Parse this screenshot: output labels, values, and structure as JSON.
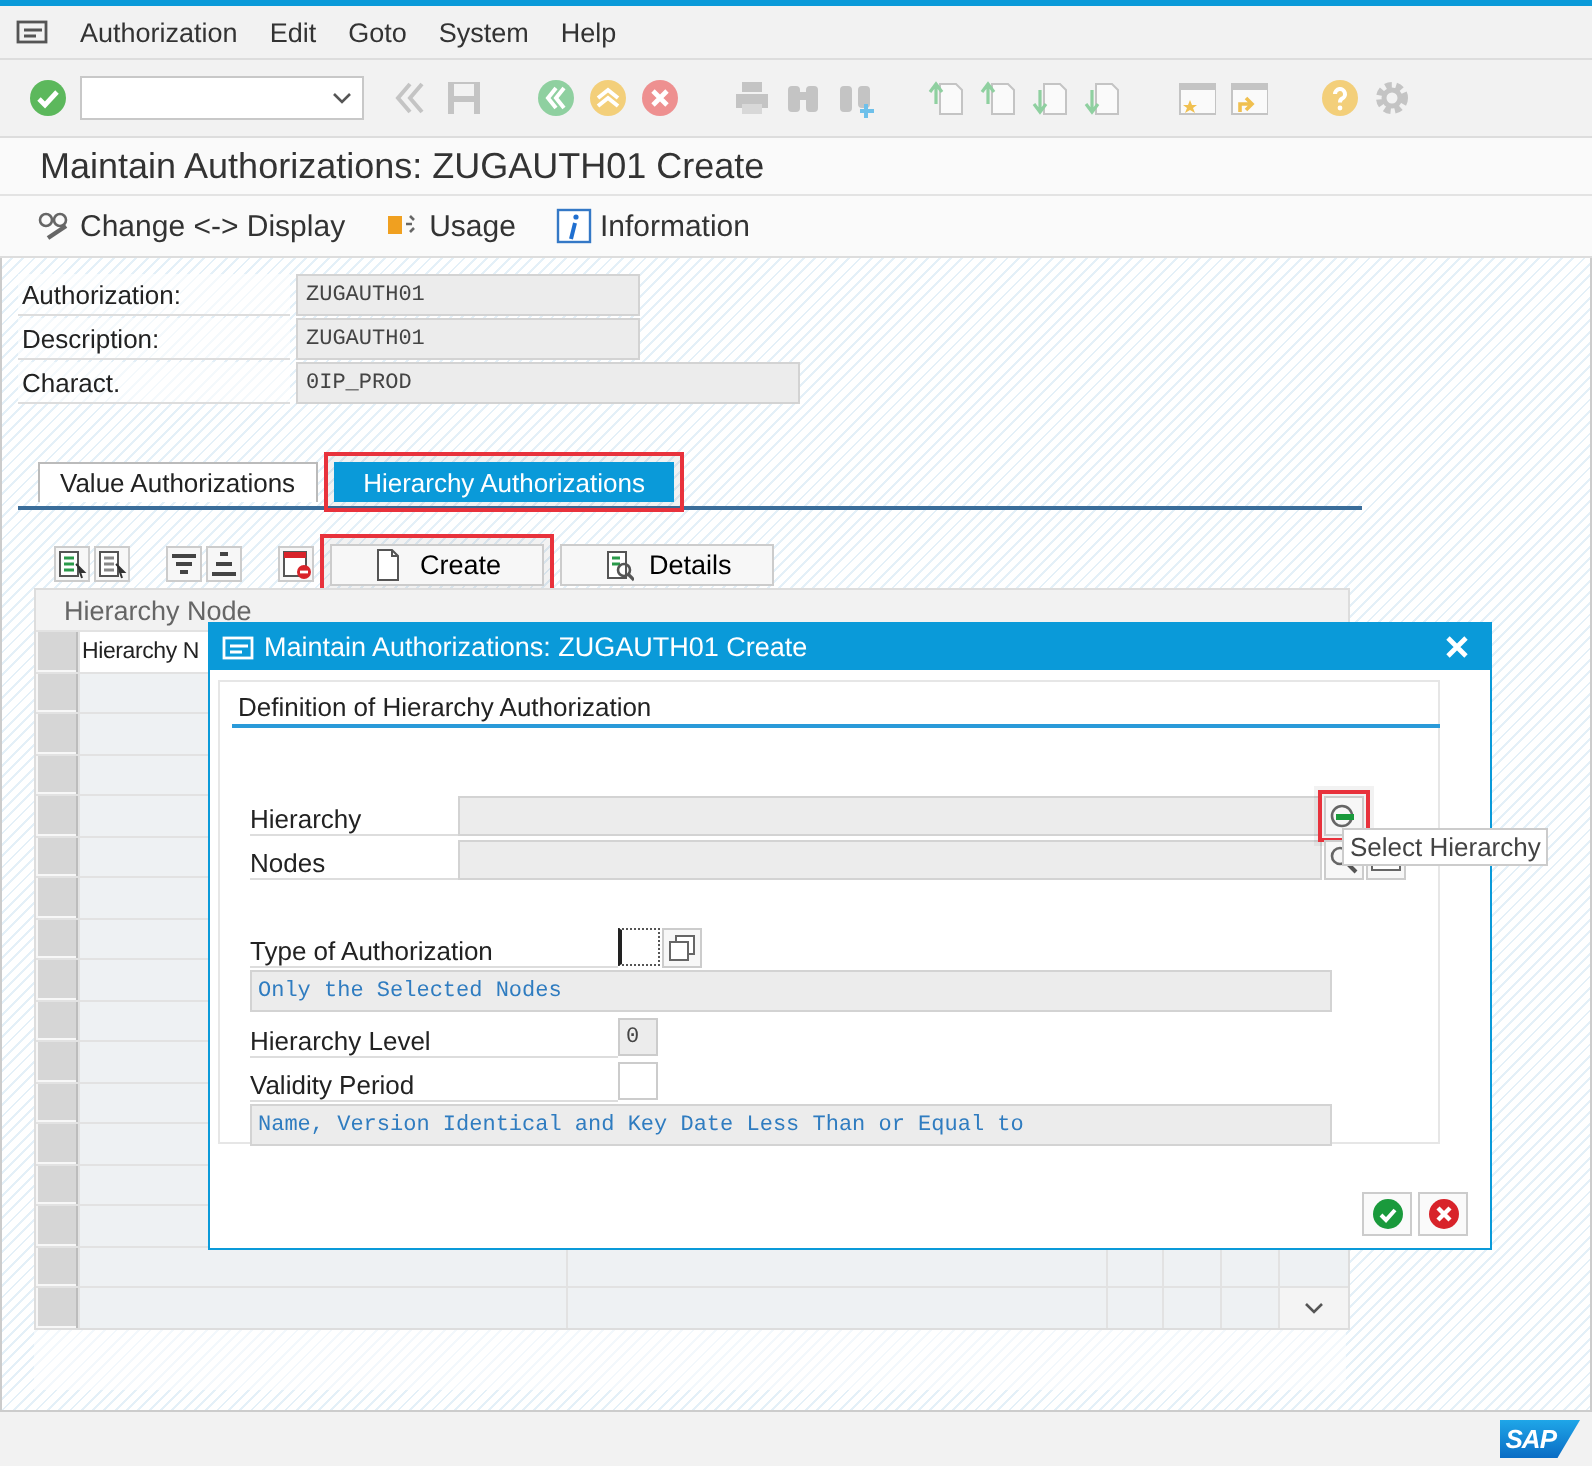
{
  "menu_bar": {
    "items": [
      "Authorization",
      "Edit",
      "Goto",
      "System",
      "Help"
    ]
  },
  "title": "Maintain Authorizations: ZUGAUTH01 Create",
  "app_toolbar": {
    "buttons": [
      {
        "kind": "glasses",
        "label": "Change <-> Display"
      },
      {
        "kind": "usage",
        "label": "Usage"
      },
      {
        "kind": "info",
        "label": "Information"
      }
    ]
  },
  "header_fields": [
    {
      "label": "Authorization:",
      "value": "ZUGAUTH01"
    },
    {
      "label": "Description:",
      "value": "ZUGAUTH01"
    },
    {
      "label": "Charact.",
      "value": "0IP_PROD"
    }
  ],
  "tabs": [
    {
      "label": "Value Authorizations",
      "selected": false,
      "highlighted": false
    },
    {
      "label": "Hierarchy Authorizations",
      "selected": true,
      "highlighted": true
    }
  ],
  "table_toolbar": {
    "buttons": [
      {
        "kind": "create",
        "label": "Create",
        "highlighted": true
      },
      {
        "kind": "details",
        "label": "Details",
        "highlighted": false
      }
    ]
  },
  "table": {
    "title": "Hierarchy Node",
    "columns": [
      "Hierarchy N"
    ]
  },
  "dialog": {
    "title": "Maintain Authorizations: ZUGAUTH01 Create",
    "group_title": "Definition of Hierarchy Authorization",
    "hierarchy": {
      "label": "Hierarchy",
      "button_highlighted": true,
      "tooltip": "Select Hierarchy"
    },
    "nodes": {
      "label": "Nodes"
    },
    "type": {
      "label": "Type of Authorization",
      "text": "Only the Selected Nodes"
    },
    "level": {
      "label": "Hierarchy Level",
      "value": "0"
    },
    "validity": {
      "label": "Validity Period",
      "text": "Name, Version Identical and Key Date Less Than or Equal to"
    }
  },
  "footer": {
    "logo": "SAP"
  }
}
